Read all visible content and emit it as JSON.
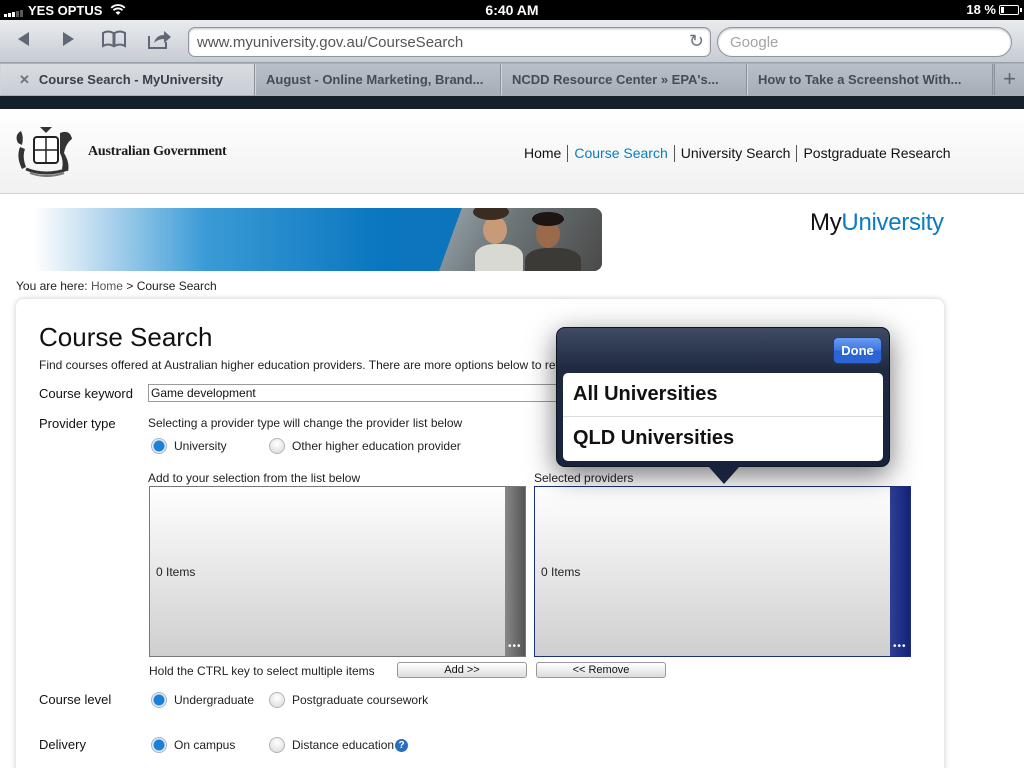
{
  "status_bar": {
    "carrier": "YES OPTUS",
    "time": "6:40 AM",
    "battery_percent": "18 %",
    "battery_level": 0.18
  },
  "browser": {
    "url": "www.myuniversity.gov.au/CourseSearch",
    "search_placeholder": "Google",
    "tabs": [
      {
        "title": "Course Search - MyUniversity"
      },
      {
        "title": "August - Online Marketing, Brand..."
      },
      {
        "title": "NCDD Resource Center » EPA's..."
      },
      {
        "title": "How to Take a Screenshot With..."
      }
    ],
    "new_tab_label": "+"
  },
  "site": {
    "gov_name": "Australian Government",
    "nav": [
      {
        "label": "Home"
      },
      {
        "label": "Course Search"
      },
      {
        "label": "University Search"
      },
      {
        "label": "Postgraduate Research"
      }
    ],
    "logo_prefix": "My",
    "logo_accent": "University",
    "accent_color": "#0a7dc2"
  },
  "breadcrumb": {
    "prefix": "You are here:",
    "home": "Home",
    "separator": ">",
    "current": "Course Search"
  },
  "form": {
    "title": "Course Search",
    "intro": "Find courses offered at Australian higher education providers. There are more options below to refine your search.",
    "keyword_label": "Course keyword",
    "keyword_value": "Game development",
    "provider_type_label": "Provider type",
    "provider_type_hint": "Selecting a provider type will change the provider list below",
    "provider_options": [
      "University",
      "Other higher education provider"
    ],
    "available_list_label": "Add to your selection from the list below",
    "selected_list_label": "Selected providers",
    "available_count": "0 Items",
    "selected_count": "0 Items",
    "ctrl_hint": "Hold the CTRL key to select multiple items",
    "add_button": "Add >>",
    "remove_button": "<< Remove",
    "course_level_label": "Course level",
    "course_level_options": [
      "Undergraduate",
      "Postgraduate coursework"
    ],
    "delivery_label": "Delivery",
    "delivery_options": [
      "On campus",
      "Distance education"
    ],
    "help_icon": "?"
  },
  "popover": {
    "done_label": "Done",
    "options": [
      "All Universities",
      "QLD Universities"
    ]
  }
}
